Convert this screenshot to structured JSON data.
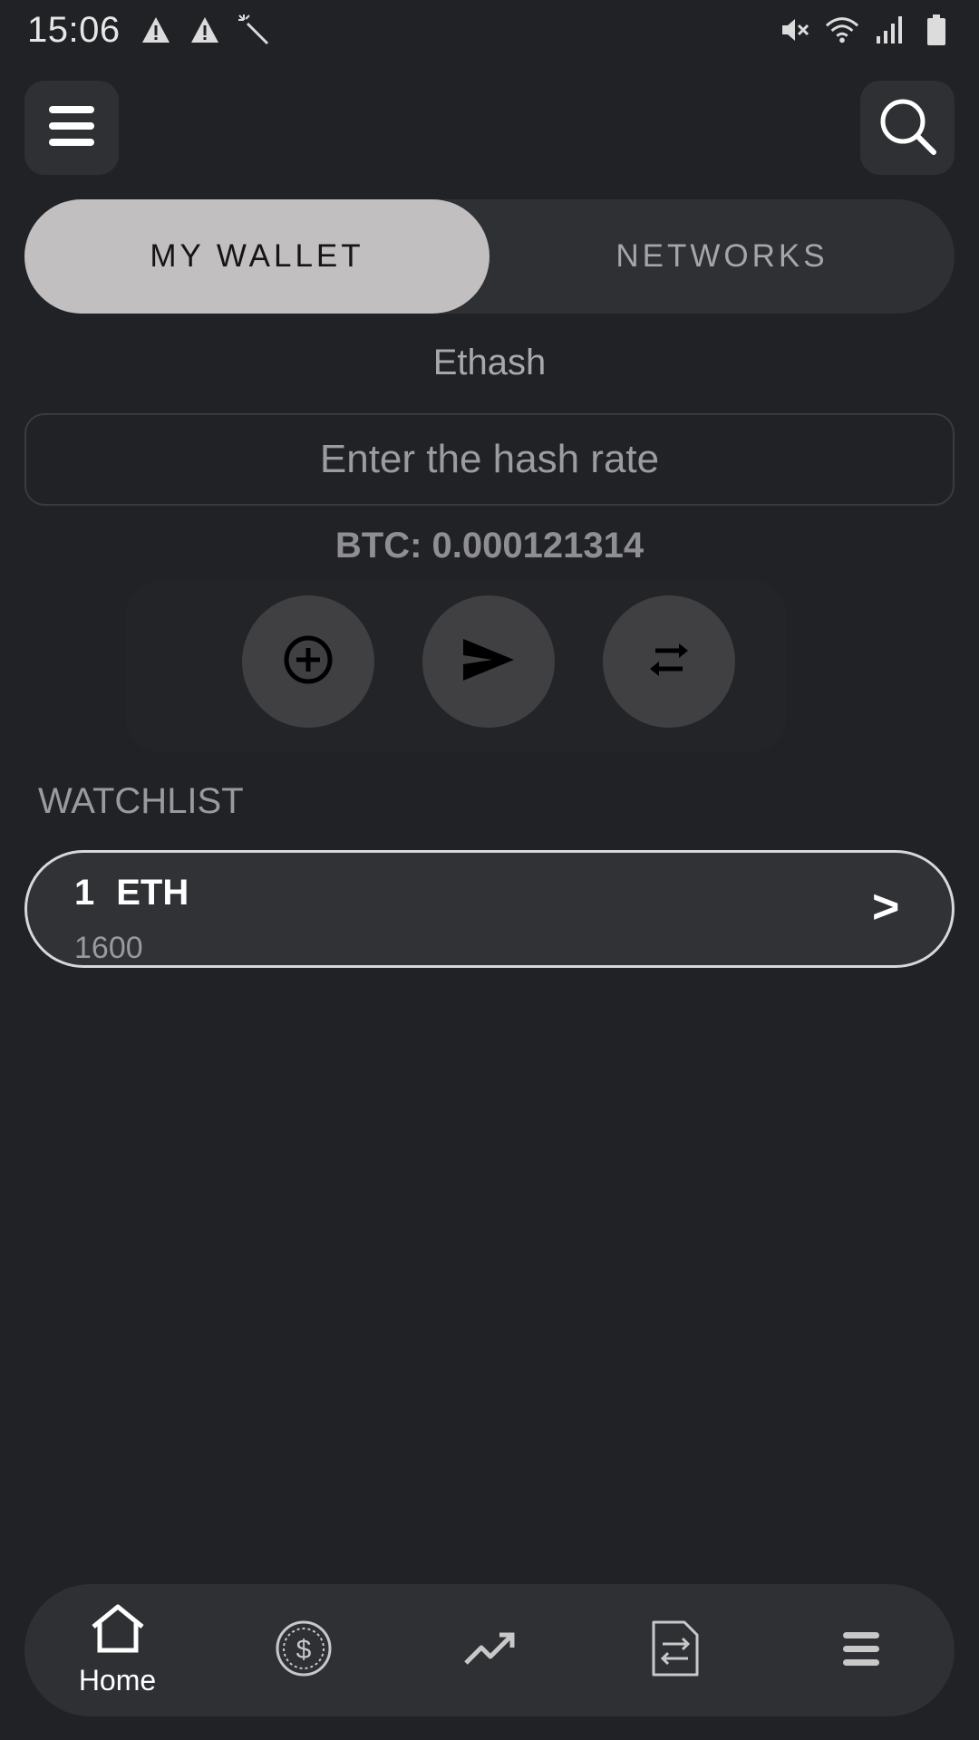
{
  "status_bar": {
    "time": "15:06",
    "left_icons": [
      "warning-icon",
      "warning-icon",
      "magic-wand-icon"
    ],
    "right_icons": [
      "mute-icon",
      "wifi-icon",
      "signal-icon",
      "battery-icon"
    ]
  },
  "header": {
    "menu_icon": "hamburger-menu-icon",
    "search_icon": "search-icon"
  },
  "tabs": [
    {
      "label": "MY WALLET",
      "active": true
    },
    {
      "label": "NETWORKS",
      "active": false
    }
  ],
  "algorithm": "Ethash",
  "hash_input": {
    "placeholder": "Enter the hash rate",
    "value": ""
  },
  "btc_value": "BTC: 0.000121314",
  "actions": [
    {
      "icon": "add-circle-icon"
    },
    {
      "icon": "send-icon"
    },
    {
      "icon": "swap-icon"
    }
  ],
  "watchlist": {
    "title": "WATCHLIST",
    "items": [
      {
        "amount": "1",
        "symbol": "ETH",
        "price": "1600",
        "chevron": ">"
      }
    ]
  },
  "bottom_nav": {
    "items": [
      {
        "label": "Home",
        "icon": "home-icon",
        "active": true
      },
      {
        "label": "",
        "icon": "coin-icon",
        "active": false
      },
      {
        "label": "",
        "icon": "trend-icon",
        "active": false
      },
      {
        "label": "",
        "icon": "exchange-document-icon",
        "active": false
      },
      {
        "label": "",
        "icon": "menu-icon",
        "active": false
      }
    ]
  },
  "colors": {
    "background": "#212226",
    "surface": "#2f3034",
    "active_tab": "#c2bfc0",
    "action_button": "#404043"
  }
}
